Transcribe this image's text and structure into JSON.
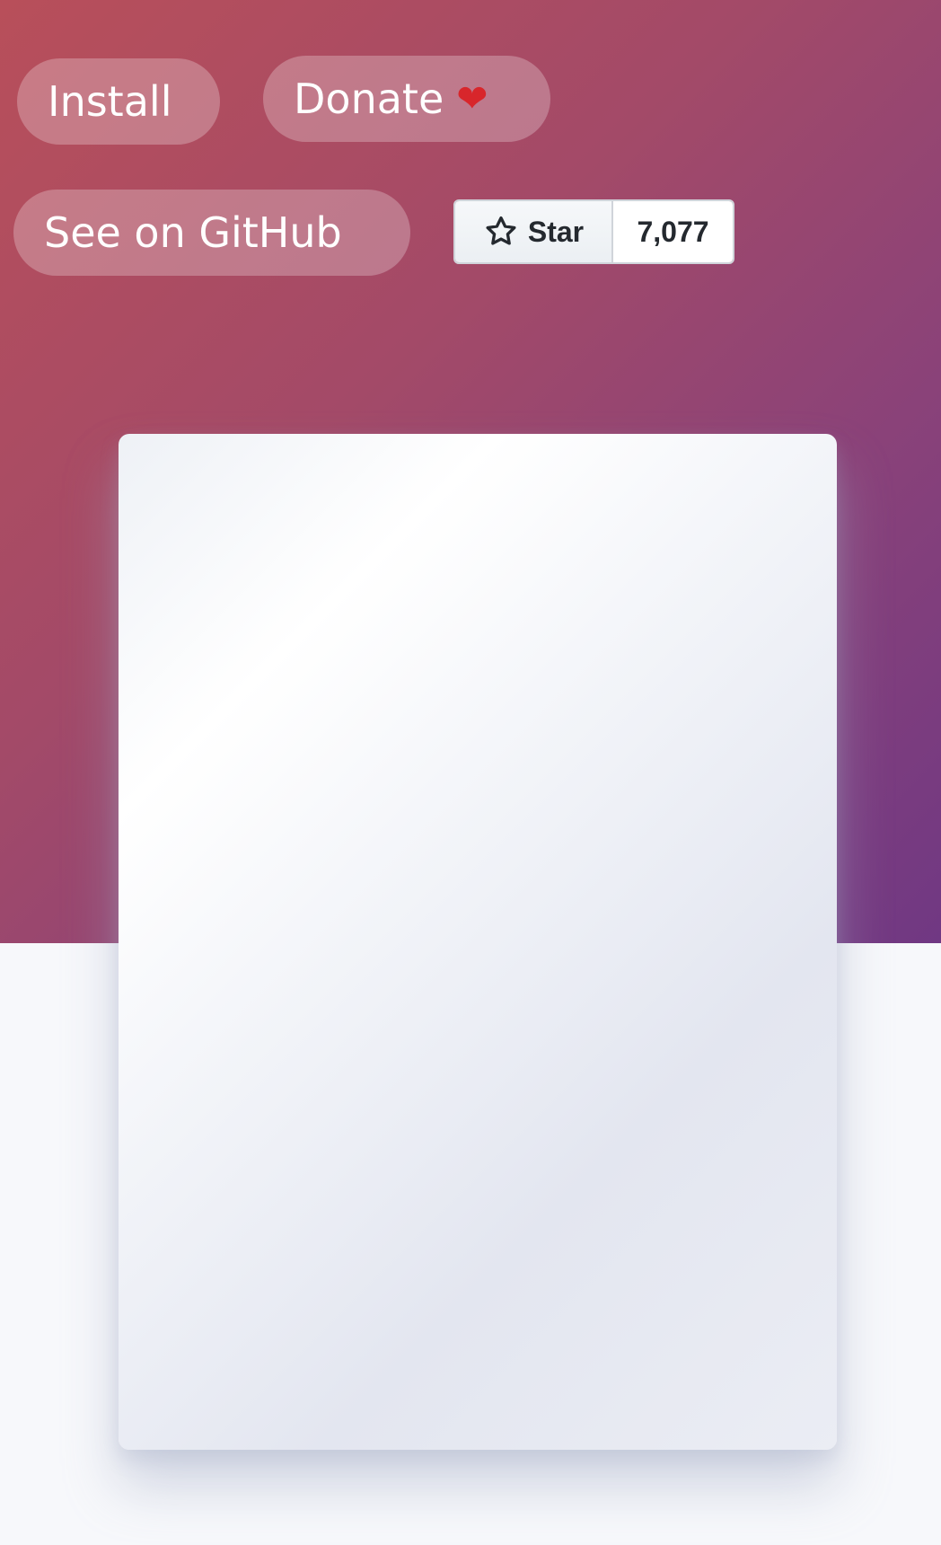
{
  "buttons": {
    "install_label": "Install",
    "donate_label": "Donate",
    "donate_heart": "❤",
    "github_label": "See on GitHub"
  },
  "github_widget": {
    "star_label": "Star",
    "star_count": "7,077"
  },
  "colors": {
    "hero_gradient_start": "#b84f5a",
    "hero_gradient_end": "#703883",
    "page_background": "#f7f8fb"
  },
  "icons": {
    "heart": "heart-icon",
    "star": "star-outline-icon"
  }
}
